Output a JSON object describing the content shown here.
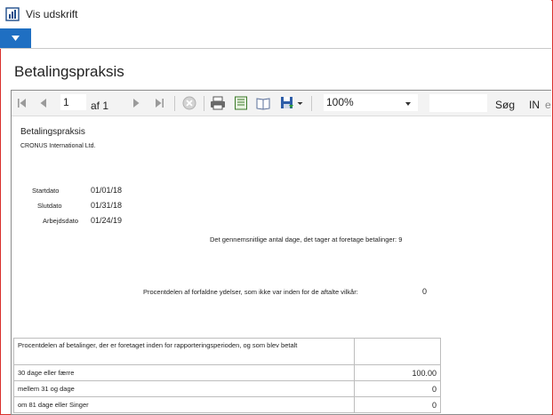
{
  "window": {
    "title": "Vis udskrift"
  },
  "page": {
    "title": "Betalingspraksis"
  },
  "toolbar": {
    "page_number": "1",
    "page_of": "af 1",
    "zoom": "100%",
    "search_label": "Søg",
    "find_label": "IN",
    "find_next_label": "e"
  },
  "report": {
    "title": "Betalingspraksis",
    "company": "CRONUS International Ltd.",
    "start_label": "Startdato",
    "start_value": "01/01/18",
    "end_label": "Slutdato",
    "end_value": "01/31/18",
    "work_label": "Arbejdsdato",
    "work_value": "01/24/19",
    "avg_days_text": "Det gennemsnitlige antal dage, det tager at foretage betalinger: 9",
    "pct_overdue_label": "Procentdelen af forfaldne ydelser, som ikke var inden for de aftalte vilkår:",
    "pct_overdue_value": "0",
    "table": {
      "header": "Procentdelen af betalinger, der er foretaget inden for rapporteringsperioden, og som blev betalt",
      "rows": [
        {
          "label": "30 dage eller færre",
          "value": "100.00"
        },
        {
          "label": "mellem 31 og dage",
          "value": "0"
        },
        {
          "label": "om 81 dage eller Singer",
          "value": "0"
        }
      ]
    }
  },
  "colors": {
    "accent": "#1f6fc2",
    "frame_border": "#d9302c"
  }
}
